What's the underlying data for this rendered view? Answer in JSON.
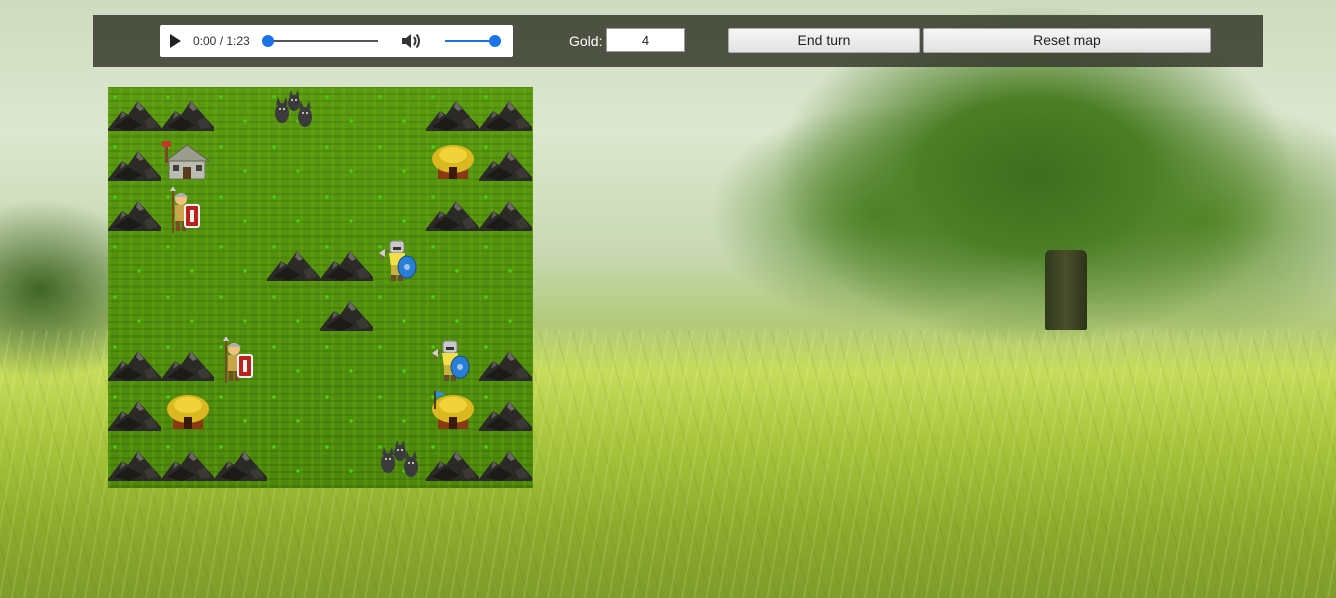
{
  "audio": {
    "time": "0:00 / 1:23",
    "progress": 0,
    "volume": 1
  },
  "gold": {
    "label": "Gold:",
    "value": "4"
  },
  "buttons": {
    "end_turn": "End turn",
    "reset_map": "Reset map"
  },
  "map": {
    "cols": 8,
    "rows": 8,
    "tiles": [
      {
        "r": 0,
        "c": 0,
        "type": "mountain"
      },
      {
        "r": 0,
        "c": 1,
        "type": "mountain"
      },
      {
        "r": 0,
        "c": 3,
        "type": "wolves"
      },
      {
        "r": 0,
        "c": 6,
        "type": "mountain"
      },
      {
        "r": 0,
        "c": 7,
        "type": "mountain"
      },
      {
        "r": 1,
        "c": 0,
        "type": "mountain"
      },
      {
        "r": 1,
        "c": 1,
        "type": "stone-house"
      },
      {
        "r": 1,
        "c": 6,
        "type": "hut"
      },
      {
        "r": 1,
        "c": 7,
        "type": "mountain"
      },
      {
        "r": 2,
        "c": 0,
        "type": "mountain"
      },
      {
        "r": 2,
        "c": 1,
        "type": "roman-soldier"
      },
      {
        "r": 2,
        "c": 6,
        "type": "mountain"
      },
      {
        "r": 2,
        "c": 7,
        "type": "mountain"
      },
      {
        "r": 3,
        "c": 3,
        "type": "mountain"
      },
      {
        "r": 3,
        "c": 4,
        "type": "mountain"
      },
      {
        "r": 3,
        "c": 5,
        "type": "dwarf-warrior"
      },
      {
        "r": 4,
        "c": 4,
        "type": "mountain"
      },
      {
        "r": 5,
        "c": 0,
        "type": "mountain"
      },
      {
        "r": 5,
        "c": 1,
        "type": "mountain"
      },
      {
        "r": 5,
        "c": 2,
        "type": "roman-soldier"
      },
      {
        "r": 5,
        "c": 6,
        "type": "dwarf-warrior"
      },
      {
        "r": 5,
        "c": 7,
        "type": "mountain"
      },
      {
        "r": 6,
        "c": 0,
        "type": "mountain"
      },
      {
        "r": 6,
        "c": 1,
        "type": "hut"
      },
      {
        "r": 6,
        "c": 6,
        "type": "hut-flag"
      },
      {
        "r": 6,
        "c": 7,
        "type": "mountain"
      },
      {
        "r": 7,
        "c": 0,
        "type": "mountain"
      },
      {
        "r": 7,
        "c": 1,
        "type": "mountain"
      },
      {
        "r": 7,
        "c": 2,
        "type": "mountain"
      },
      {
        "r": 7,
        "c": 5,
        "type": "wolves"
      },
      {
        "r": 7,
        "c": 6,
        "type": "mountain"
      },
      {
        "r": 7,
        "c": 7,
        "type": "mountain"
      }
    ]
  },
  "colors": {
    "grass": "#4f8a0c",
    "accent_blue": "#1a73e8",
    "toolbar_bg": "#3a3e30"
  }
}
